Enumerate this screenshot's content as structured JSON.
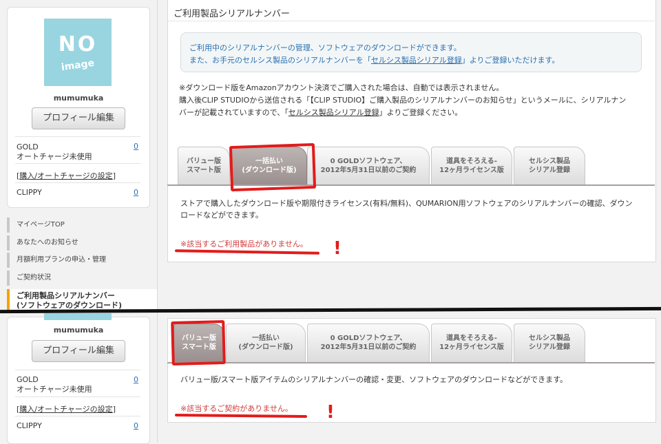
{
  "profile": {
    "image_text_1": "NO",
    "image_text_2": "image",
    "username": "mumumuka",
    "edit_button": "プロフィール編集",
    "gold_label": "GOLD",
    "gold_value": "0",
    "autocharge": "オートチャージ未使用",
    "purchase_link_open": "[",
    "purchase_link": "購入/オートチャージの設定",
    "purchase_link_close": "]",
    "clippy_label": "CLIPPY",
    "clippy_value": "0"
  },
  "menu": {
    "items": [
      "マイページTOP",
      "あなたへのお知らせ",
      "月額利用プランの申込・管理",
      "ご契約状況"
    ],
    "active_line1": "ご利用製品シリアルナンバー",
    "active_line2": "(ソフトウェアのダウンロード)"
  },
  "main": {
    "title": "ご利用製品シリアルナンバー",
    "info_1": "ご利用中のシリアルナンバーの管理、ソフトウェアのダウンロードができます。",
    "info_2_pre": "また、お手元のセルシス製品のシリアルナンバーを「",
    "info_2_link": "セルシス製品シリアル登録",
    "info_2_post": "」よりご登録いただけます。",
    "note_1": "※ダウンロード版をAmazonアカウント決済でご購入された場合は、自動では表示されません。",
    "note_2": "購入後CLIP STUDIOから送信される「【CLIP STUDIO】ご購入製品のシリアルナンバーのお知らせ」というメールに、シリアルナン",
    "note_3_pre": "バーが記載されていますので、「",
    "note_3_link": "セルシス製品シリアル登録",
    "note_3_post": "」よりご登録ください。"
  },
  "tabs": [
    {
      "line1": "バリュー版",
      "line2": "スマート版"
    },
    {
      "line1": "一括払い",
      "line2": "(ダウンロード版)"
    },
    {
      "line1": "0 GOLDソフトウェア、",
      "line2": "2012年5月31日以前のご契約"
    },
    {
      "line1": "道具をそろえる-",
      "line2": "12ヶ月ライセンス版"
    },
    {
      "line1": "セルシス製品",
      "line2": "シリアル登録"
    }
  ],
  "section_top": {
    "desc_1": "ストアで購入したダウンロード版や期限付きライセンス(有料/無料)、QUMARION用ソフトウェアのシリアルナンバーの確認、ダウン",
    "desc_2": "ロードなどができます。",
    "warning": "※該当するご利用製品がありません。"
  },
  "section_bottom": {
    "desc": "バリュー版/スマート版アイテムのシリアルナンバーの確認・変更、ソフトウェアのダウンロードなどができます。",
    "warning": "※該当するご契約がありません。"
  },
  "annotations": {
    "exclaim": "!"
  },
  "colors": {
    "accent_blue": "#2a6fb0",
    "warning_red": "#d23a3a",
    "highlight_red": "#e21b1b",
    "active_menu": "#f2a400"
  }
}
